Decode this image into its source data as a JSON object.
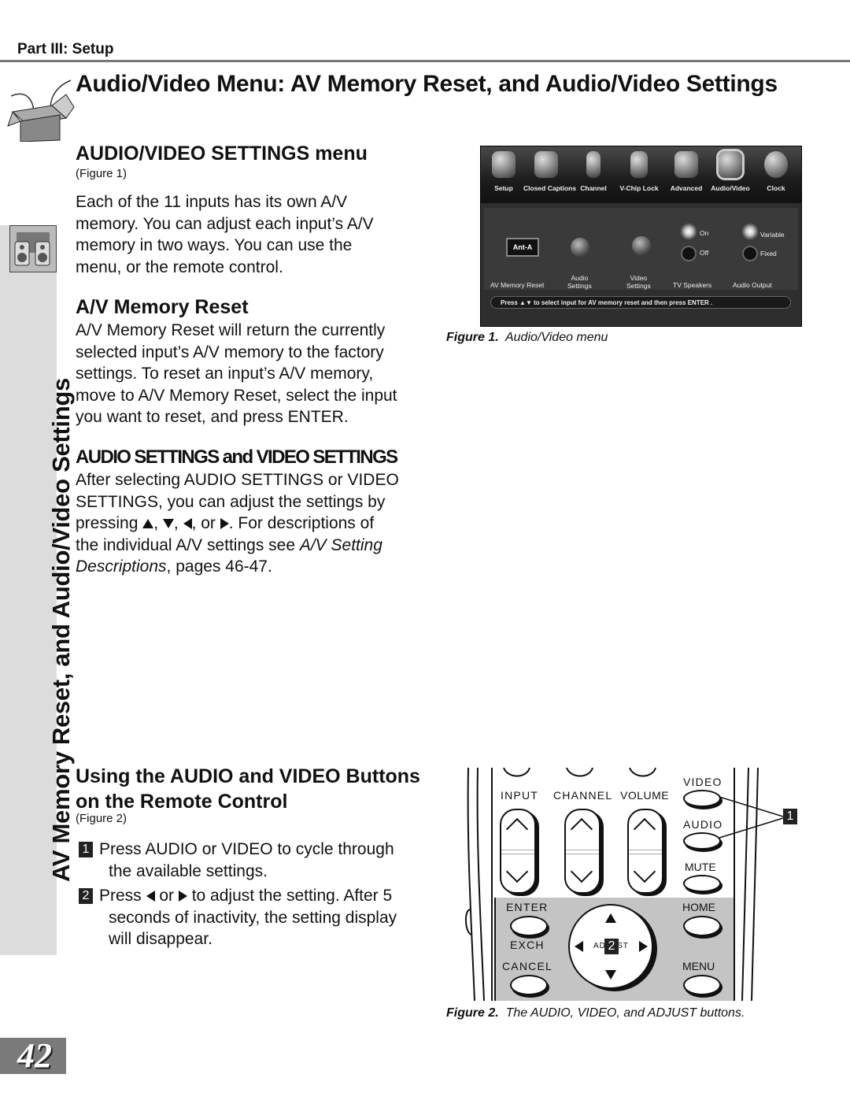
{
  "header": {
    "part_label": "Part III: Setup",
    "title": "Audio/Video Menu: AV Memory Reset, and Audio/Video Settings",
    "title_icon": "open-box-icon"
  },
  "side_tab": {
    "icon": "speakers-icon",
    "text": "AV Memory Reset, and Audio/Video Settings"
  },
  "section_av_settings": {
    "heading": "AUDIO/VIDEO SETTINGS menu",
    "figure_ref": "(Figure 1)",
    "body": [
      "Each of the 11 inputs has its own A/V",
      "memory.  You can adjust each input’s A/V",
      "memory in two ways.  You can use the",
      "menu, or the remote control."
    ]
  },
  "section_memory_reset": {
    "heading": "A/V Memory Reset",
    "body": [
      "A/V Memory Reset will return the currently",
      "selected input’s A/V memory to the factory",
      "settings.  To reset an input’s A/V memory,",
      "move to A/V Memory Reset, select the input",
      "you want to reset, and press ENTER."
    ]
  },
  "section_audio_video_settings": {
    "heading": "AUDIO SETTINGS and VIDEO SETTINGS",
    "line1": "After selecting AUDIO SETTINGS or VIDEO",
    "line2": "SETTINGS, you can adjust the settings by",
    "line3_a": "pressing ",
    "line3_sep1": ", ",
    "line3_sep2": ", ",
    "line3_sep3": ", or ",
    "line3_b": ".  For descriptions of",
    "line4_a": "the individual A/V settings see ",
    "line4_italic": "A/V Setting",
    "line5_italic": "Descriptions",
    "line5_b": ", pages 46-47."
  },
  "section_remote": {
    "heading_line1": "Using the AUDIO and VIDEO Buttons",
    "heading_line2": "on the Remote Control",
    "figure_ref": "(Figure 2)",
    "steps": [
      {
        "num": "1",
        "line1": "Press AUDIO or VIDEO to cycle through",
        "line2": "the available settings."
      },
      {
        "num": "2",
        "line1_a": "Press ",
        "line1_b": " or ",
        "line1_c": " to adjust the setting.  After 5",
        "line2": "seconds of inactivity, the setting display",
        "line3": "will disappear."
      }
    ]
  },
  "figure1": {
    "caption_label": "Figure 1.",
    "caption_text": "Audio/Video menu",
    "menu_tabs": [
      {
        "label": "Setup",
        "icon": "camera-icon"
      },
      {
        "label": "Closed Captions",
        "icon": "cc-icon"
      },
      {
        "label": "Channel",
        "icon": "channel-arrows-icon"
      },
      {
        "label": "V-Chip Lock",
        "icon": "lock-icon"
      },
      {
        "label": "Advanced",
        "icon": "advanced-icon"
      },
      {
        "label": "Audio/Video",
        "icon": "speakers-icon",
        "active": true
      },
      {
        "label": "Clock",
        "icon": "clock-icon"
      }
    ],
    "input_value": "Ant-A",
    "controls": {
      "av_memory_reset": "AV Memory Reset",
      "audio_settings_1": "Audio",
      "audio_settings_2": "Settings",
      "video_settings_1": "Video",
      "video_settings_2": "Settings",
      "tv_speakers": "TV  Speakers",
      "tv_speakers_on": "On",
      "tv_speakers_off": "Off",
      "tv_speakers_selected": "On",
      "audio_output": "Audio Output",
      "audio_output_variable": "Variable",
      "audio_output_fixed": "Fixed",
      "audio_output_selected": "Variable"
    },
    "help_text_a": "Press ",
    "help_arrows": "▲▼",
    "help_text_b": " to select input for AV memory reset  and then press ENTER ."
  },
  "figure2": {
    "caption_label": "Figure 2.",
    "caption_text": "The AUDIO, VIDEO, and ADJUST buttons.",
    "buttons": {
      "input": "INPUT",
      "channel": "CHANNEL",
      "volume": "VOLUME",
      "video": "VIDEO",
      "audio": "AUDIO",
      "mute": "MUTE",
      "enter": "ENTER",
      "home": "HOME",
      "exch": "EXCH",
      "cancel": "CANCEL",
      "menu": "MENU",
      "adjust": "ADJUST"
    },
    "callout_1": "1",
    "callout_2": "2"
  },
  "page_number": "42"
}
